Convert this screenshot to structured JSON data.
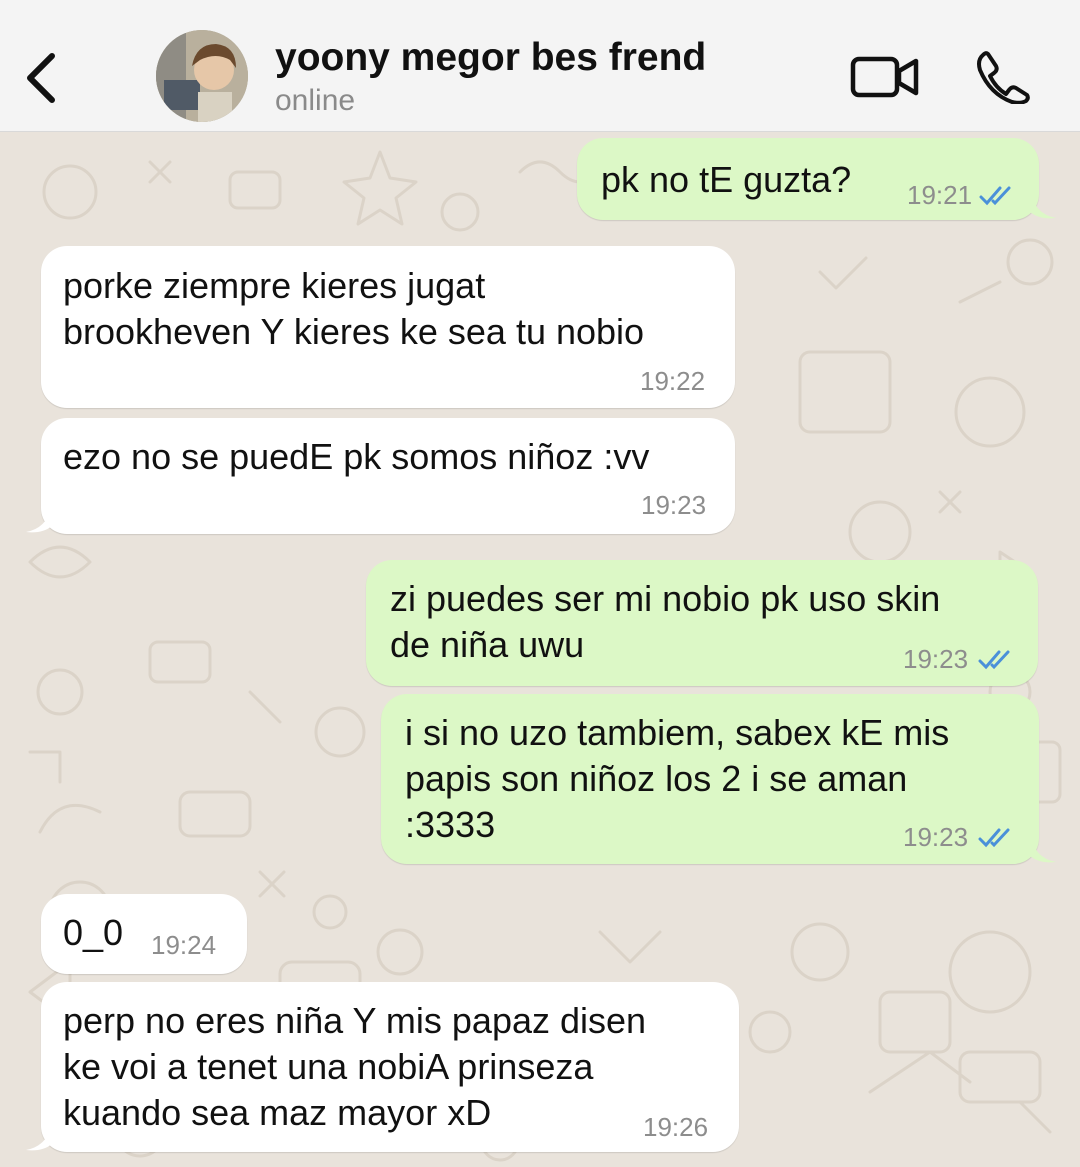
{
  "header": {
    "contact_name": "yoony megor bes frend",
    "status": "online"
  },
  "messages": [
    {
      "direction": "out",
      "lines": [
        "pk no tE guzta?"
      ],
      "time": "19:21",
      "read": true
    },
    {
      "direction": "in",
      "lines": [
        "porke ziempre kieres jugat",
        "brookheven Y kieres ke sea tu nobio"
      ],
      "time": "19:22"
    },
    {
      "direction": "in",
      "lines": [
        "ezo no se puedE pk somos niñoz :vv"
      ],
      "time": "19:23"
    },
    {
      "direction": "out",
      "lines": [
        "zi puedes ser mi nobio pk uso skin",
        "de niña uwu"
      ],
      "time": "19:23",
      "read": true
    },
    {
      "direction": "out",
      "lines": [
        "i si no uzo tambiem, sabex kE mis",
        "papis son niñoz los 2 i se aman",
        ":3333"
      ],
      "time": "19:23",
      "read": true
    },
    {
      "direction": "in",
      "lines": [
        "0_0"
      ],
      "time": "19:24"
    },
    {
      "direction": "in",
      "lines": [
        "perp no eres niña Y mis papaz disen",
        "ke voi a tenet una nobiA prinseza",
        "kuando sea maz mayor xD"
      ],
      "time": "19:26"
    }
  ],
  "colors": {
    "outgoing_bubble": "#dcf8c6",
    "incoming_bubble": "#ffffff",
    "read_ticks": "#4a90d9",
    "wallpaper": "#e9e3db"
  },
  "icons": [
    "chevron-left-icon",
    "video-camera-icon",
    "phone-icon",
    "double-check-icon"
  ]
}
